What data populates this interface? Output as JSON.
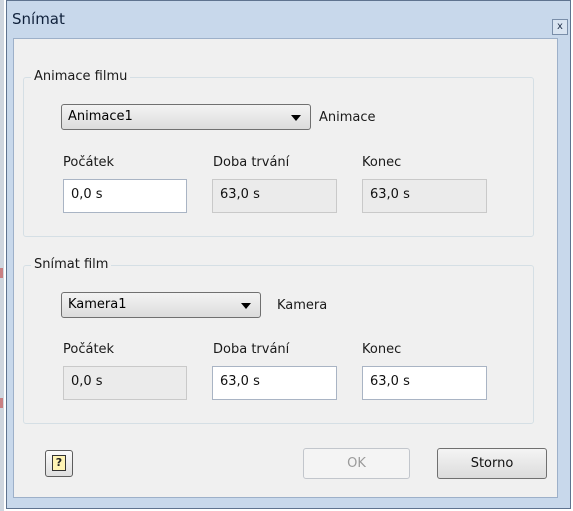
{
  "window": {
    "title": "Snímat",
    "close_glyph": "x"
  },
  "animation_group": {
    "legend": "Animace filmu",
    "combo_value": "Animace1",
    "side_label": "Animace",
    "start_label": "Počátek",
    "start_value": "0,0 s",
    "duration_label": "Doba trvání",
    "duration_value": "63,0 s",
    "end_label": "Konec",
    "end_value": "63,0 s"
  },
  "record_group": {
    "legend": "Snímat film",
    "combo_value": "Kamera1",
    "side_label": "Kamera",
    "start_label": "Počátek",
    "start_value": "0,0 s",
    "duration_label": "Doba trvání",
    "duration_value": "63,0 s",
    "end_label": "Konec",
    "end_value": "63,0 s"
  },
  "footer": {
    "help_glyph": "?",
    "ok_label": "OK",
    "cancel_label": "Storno"
  }
}
